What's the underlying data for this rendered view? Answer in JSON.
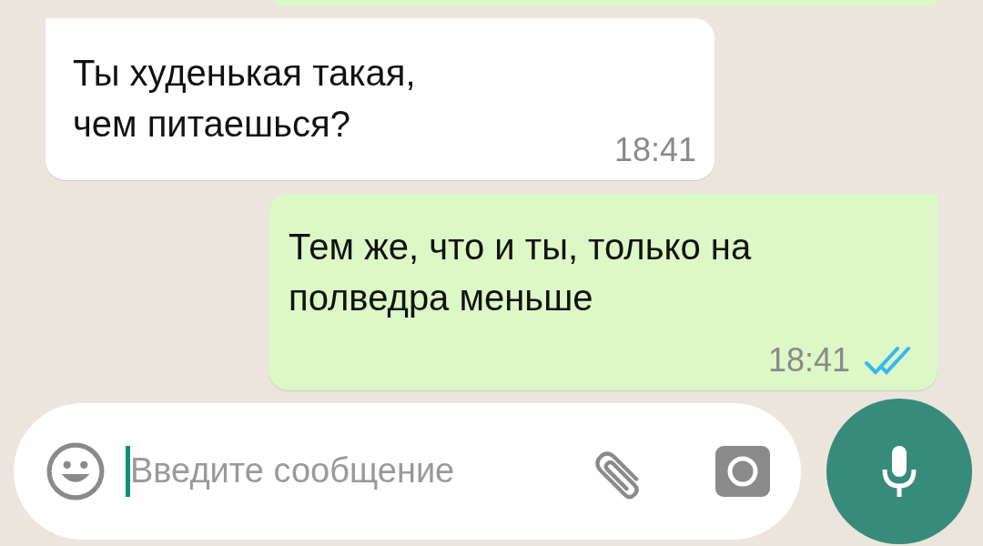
{
  "messages": [
    {
      "outgoing": false,
      "text": "Ты худенькая такая,\nчем питаешься?",
      "time": "18:41"
    },
    {
      "outgoing": true,
      "text": "Тем же, что и ты, только на\nполведра меньше",
      "time": "18:41",
      "read": true
    }
  ],
  "composer": {
    "placeholder": "Введите сообщение"
  }
}
